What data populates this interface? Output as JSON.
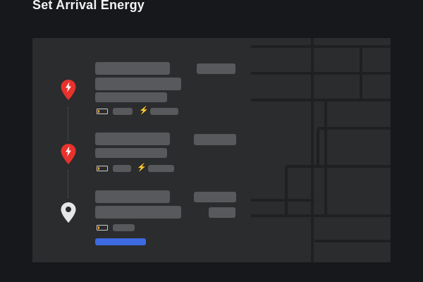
{
  "title": "Set Arrival Energy",
  "colors": {
    "background": "#16181b",
    "map": "#2b2c2e",
    "placeholder": "#58595c",
    "charger_pin": "#e8322c",
    "destination_pin": "#e6e6e6",
    "battery_level": "#e8a33a",
    "primary_button": "#3e6ae1"
  },
  "stops": [
    {
      "type": "supercharger",
      "icon": "charger-pin-icon"
    },
    {
      "type": "supercharger",
      "icon": "charger-pin-icon"
    },
    {
      "type": "destination",
      "icon": "destination-pin-icon"
    }
  ]
}
